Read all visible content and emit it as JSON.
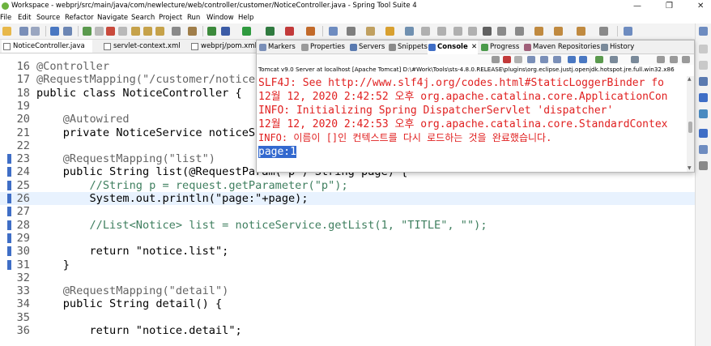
{
  "window": {
    "title": "Workspace - webprj/src/main/java/com/newlecture/web/controller/customer/NoticeController.java - Spring Tool Suite 4",
    "minimize_glyph": "—",
    "restore_glyph": "❐",
    "close_glyph": "✕"
  },
  "menu": [
    "File",
    "Edit",
    "Source",
    "Refactor",
    "Navigate",
    "Search",
    "Project",
    "Run",
    "Window",
    "Help"
  ],
  "editor_tabs": [
    "NoticeController.java",
    "servlet-context.xml",
    "webprj/pom.xml"
  ],
  "view_tabs": [
    "Markers",
    "Properties",
    "Servers",
    "Snippets",
    "Console",
    "Progress",
    "Maven Repositories",
    "History"
  ],
  "console": {
    "description": "Tomcat v9.0 Server at localhost [Apache Tomcat] D:\\#Work\\Tools\\sts-4.8.0.RELEASE\\plugins\\org.eclipse.justj.openjdk.hotspot.jre.full.win32.x86",
    "close_glyph": "✕",
    "lines": [
      "SLF4J: See http://www.slf4j.org/codes.html#StaticLoggerBinder fo",
      "12월 12, 2020 2:42:52 오후 org.apache.catalina.core.ApplicationCon",
      "INFO: Initializing Spring DispatcherServlet 'dispatcher'",
      "12월 12, 2020 2:42:53 오후 org.apache.catalina.core.StandardContex",
      "INFO: 이름이 []인 컨텍스트를 다시 로드하는 것을 완료했습니다.",
      "page:1"
    ]
  },
  "code": [
    {
      "n": "16",
      "t": "@Controller"
    },
    {
      "n": "17",
      "t": "@RequestMapping(\"/customer/notice/\")"
    },
    {
      "n": "18",
      "t": "public class NoticeController {"
    },
    {
      "n": "19",
      "t": ""
    },
    {
      "n": "20",
      "t": "    @Autowired"
    },
    {
      "n": "21",
      "t": "    private NoticeService noticeService;"
    },
    {
      "n": "22",
      "t": ""
    },
    {
      "n": "23",
      "t": "    @RequestMapping(\"list\")"
    },
    {
      "n": "24",
      "t": "    public String list(@RequestParam(\"p\") String page) {"
    },
    {
      "n": "25",
      "t": "        //String p = request.getParameter(\"p\");"
    },
    {
      "n": "26",
      "t": "        System.out.println(\"page:\"+page);"
    },
    {
      "n": "27",
      "t": ""
    },
    {
      "n": "28",
      "t": "        //List<Notice> list = noticeService.getList(1, \"TITLE\", \"\");"
    },
    {
      "n": "29",
      "t": ""
    },
    {
      "n": "30",
      "t": "        return \"notice.list\";"
    },
    {
      "n": "31",
      "t": "    }"
    },
    {
      "n": "32",
      "t": ""
    },
    {
      "n": "33",
      "t": "    @RequestMapping(\"detail\")"
    },
    {
      "n": "34",
      "t": "    public String detail() {"
    },
    {
      "n": "35",
      "t": ""
    },
    {
      "n": "36",
      "t": "        return \"notice.detail\";"
    }
  ]
}
